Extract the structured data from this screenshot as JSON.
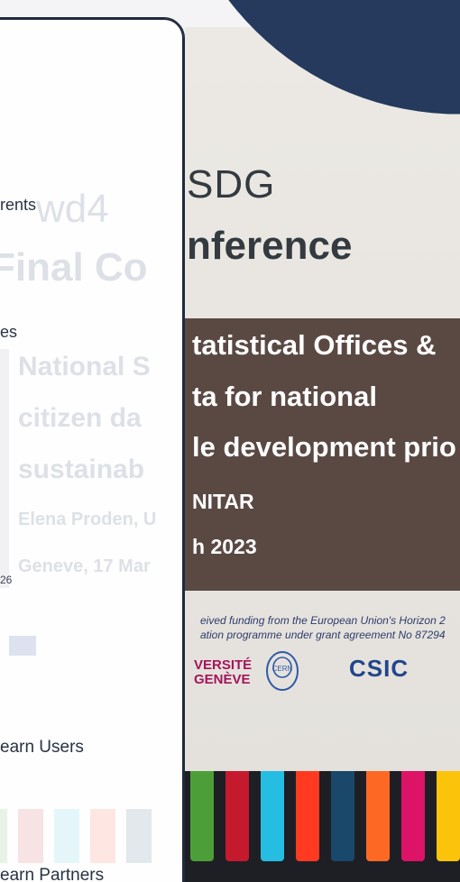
{
  "photo": {
    "title_line1": "SDG",
    "title_line2": "nference",
    "panel_lines": [
      "tatistical Offices &",
      "ta for national",
      "le development prio"
    ],
    "presenter": "NITAR",
    "date": "h 2023",
    "funding_line1": "eived funding from the European Union's Horizon 2",
    "funding_line2": "ation programme under grant agreement No 87294",
    "logos": {
      "unige_line1": "VERSITÉ",
      "unige_line2": "GENÈVE",
      "csic": "CSIC"
    },
    "sdg_colors": [
      "#4c9f38",
      "#c5192d",
      "#26bde2",
      "#ff3a21",
      "#19486a",
      "#fd6925",
      "#dd1367",
      "#fcc30b"
    ]
  },
  "ghost": {
    "title_line1": "wd4",
    "title_line2": "Final Co",
    "panel_lines": [
      "National S",
      "citizen da",
      "sustainab"
    ],
    "presenter": "Elena Proden, U",
    "date": "Geneve, 17 Mar"
  },
  "menu": {
    "item1": "rents",
    "item2": "es",
    "number": "26",
    "item3": "earn Users",
    "item4": "earn Partners"
  }
}
